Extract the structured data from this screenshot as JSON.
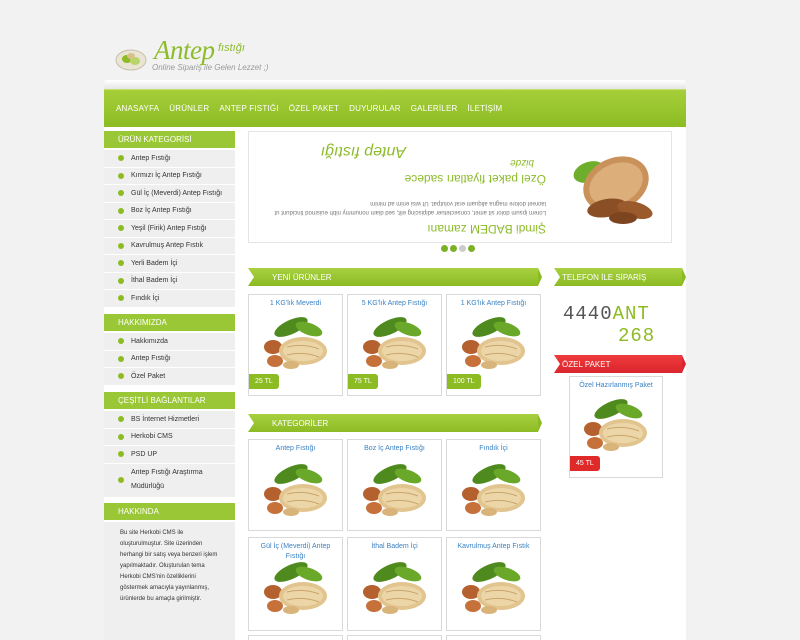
{
  "logo": {
    "title": "Antep",
    "title_small": "fıstığı",
    "tagline": "Online Sipariş ile Gelen Lezzet ;)"
  },
  "nav": {
    "items": [
      "ANASAYFA",
      "ÜRÜNLER",
      "ANTEP FISTIĞI",
      "ÖZEL PAKET",
      "DUYURULAR",
      "GALERİLER",
      "İLETİŞİM"
    ]
  },
  "sidebar": {
    "categories_title": "ÜRÜN KATEGORİSİ",
    "categories": [
      "Antep Fıstığı",
      "Kırmızı İç Antep Fıstığı",
      "Gül İç (Meverdi) Antep Fıstığı",
      "Boz İç Antep Fıstığı",
      "Yeşil (Firik) Antep Fıstığı",
      "Kavrulmuş Antep Fıstık",
      "Yerli Badem İçi",
      "İthal Badem İçi",
      "Fındık İçi"
    ],
    "about_title": "HAKKIMIZDA",
    "about_items": [
      "Hakkımızda",
      "Antep Fıstığı",
      "Özel Paket"
    ],
    "links_title": "ÇEŞİTLİ BAĞLANTILAR",
    "links": [
      "BS İnternet Hizmetleri",
      "Herkobi CMS",
      "PSD UP",
      "Antep Fıstığı Araştırma Müdürlüğü"
    ],
    "info_title": "HAKKINDA",
    "info_text": "Bu site Herkobi CMS ile oluşturulmuştur. Site üzerinden herhangi bir satış veya benzeri işlem yapılmaktadır. Oluşturulan tema Herkobi CMS'nin özelliklerini göstermek amacıyla yayınlanmış, ürünlerde bu amaçla girilmiştir."
  },
  "slider": {
    "headline": "Şimdi BADEM zamanı",
    "lorem": "Lorem ipsum dolor sit amet, consectetuer adipiscing elit, sed diam nonummy nibh euismod tincidunt ut laoreet dolore magna aliquam erat volutpat. Ut wisi enim ad minim",
    "offer": "Özel paket fiyatları sadece",
    "offer_small": "bizde",
    "brand": "Antep fıstığı"
  },
  "new_products": {
    "title": "YENİ ÜRÜNLER",
    "items": [
      {
        "name": "1 KG'lık Meverdi",
        "price": "25 TL"
      },
      {
        "name": "5 KG'lık Antep Fıstığı",
        "price": "75 TL"
      },
      {
        "name": "1 KG'lık Antep Fıstığı",
        "price": "100 TL"
      }
    ]
  },
  "categories": {
    "title": "KATEGORİLER",
    "items": [
      {
        "name": "Antep Fıstığı"
      },
      {
        "name": "Boz İç Antep Fıstığı"
      },
      {
        "name": "Fındık İçi"
      },
      {
        "name": "Gül İç (Meverdi) Antep Fıstığı"
      },
      {
        "name": "İthal Badem İçi"
      },
      {
        "name": "Kavrulmuş Antep Fıstık"
      }
    ]
  },
  "phone_order": {
    "title": "TELEFON İLE SİPARİŞ",
    "digits_gray": "4440",
    "digits_green_1": "ANT",
    "digits_green_2": "268"
  },
  "special_package": {
    "title": "ÖZEL PAKET",
    "name": "Özel Hazırlanmış Paket",
    "price": "45 TL"
  },
  "colors": {
    "brand_green": "#8cbb23",
    "accent_red": "#e02a2a",
    "link_blue": "#3a82c4"
  }
}
